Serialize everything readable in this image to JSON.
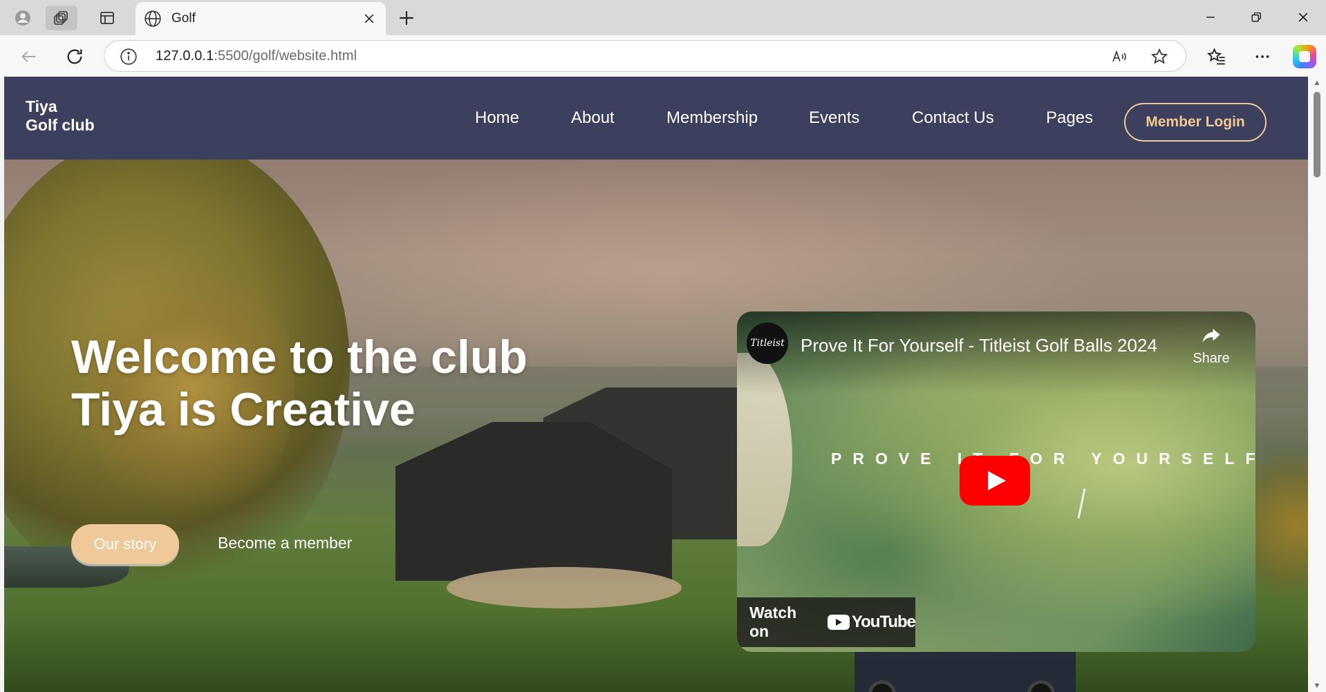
{
  "browser": {
    "tab_title": "Golf",
    "url_host": "127.0.0.1",
    "url_rest": ":5500/golf/website.html"
  },
  "site": {
    "brand_line1": "Tiya",
    "brand_line2": "Golf club",
    "nav": [
      {
        "label": "Home"
      },
      {
        "label": "About"
      },
      {
        "label": "Membership"
      },
      {
        "label": "Events"
      },
      {
        "label": "Contact Us"
      },
      {
        "label": "Pages"
      }
    ],
    "login_label": "Member Login",
    "colors": {
      "navbar": "#3d3f5f",
      "accent": "#f0c99b"
    }
  },
  "hero": {
    "title_line1": "Welcome to the club",
    "title_line2": "Tiya is Creative",
    "primary_button": "Our story",
    "secondary_link": "Become a member"
  },
  "video": {
    "channel_logo_text": "Titleist",
    "title": "Prove It For Yourself - Titleist Golf Balls 2024",
    "share_label": "Share",
    "tagline": "PROVE IT FOR YOURSELF",
    "watch_on_label": "Watch on",
    "youtube_word": "YouTube"
  }
}
